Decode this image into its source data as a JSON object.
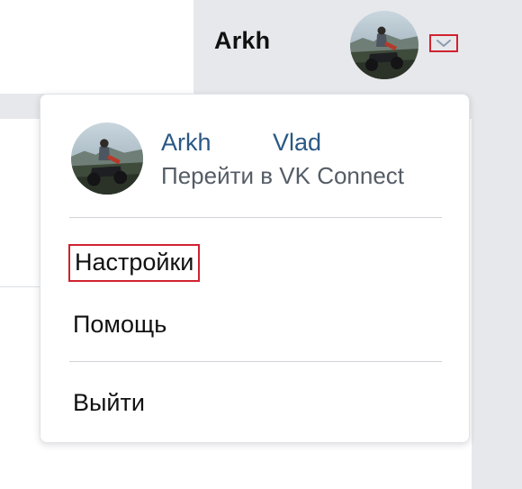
{
  "header": {
    "user_name": "Arkh",
    "avatar_icon": "user-avatar-icon",
    "dropdown_icon": "chevron-down-icon",
    "highlight_color": "#d0232f"
  },
  "menu": {
    "profile": {
      "first_name": "Arkh",
      "last_name": "Vlad",
      "vk_connect_link": "Перейти в VK Connect"
    },
    "items": [
      {
        "label": "Настройки",
        "highlighted": true
      },
      {
        "label": "Помощь"
      },
      {
        "label": "Выйти"
      }
    ]
  },
  "colors": {
    "link": "#2a5885",
    "header_bg": "#e7e8ec",
    "text": "#111111"
  }
}
